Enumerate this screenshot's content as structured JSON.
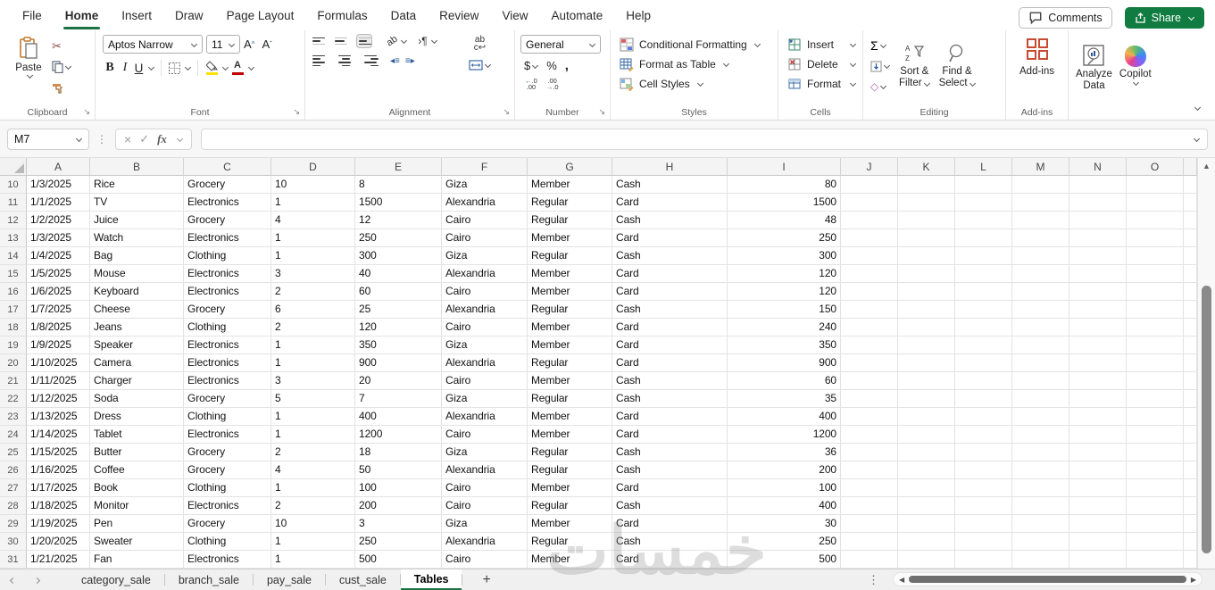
{
  "colors": {
    "excel_green": "#107C41",
    "active_tab_underline": "#1E7145",
    "fill_swatch": "#FFE100",
    "fontcolor_swatch": "#C00000"
  },
  "ribbon": {
    "tabs": [
      {
        "label": "File",
        "active": false
      },
      {
        "label": "Home",
        "active": true
      },
      {
        "label": "Insert",
        "active": false
      },
      {
        "label": "Draw",
        "active": false
      },
      {
        "label": "Page Layout",
        "active": false
      },
      {
        "label": "Formulas",
        "active": false
      },
      {
        "label": "Data",
        "active": false
      },
      {
        "label": "Review",
        "active": false
      },
      {
        "label": "View",
        "active": false
      },
      {
        "label": "Automate",
        "active": false
      },
      {
        "label": "Help",
        "active": false
      }
    ],
    "comments_label": "Comments",
    "share_label": "Share",
    "clipboard": {
      "label": "Clipboard",
      "paste": "Paste"
    },
    "font": {
      "label": "Font",
      "font_name": "Aptos Narrow",
      "font_size": "11",
      "bold": "B",
      "italic": "I",
      "underline": "U"
    },
    "alignment": {
      "label": "Alignment",
      "wrap": "ab"
    },
    "number": {
      "label": "Number",
      "format": "General",
      "currency": "$",
      "percent": "%",
      "comma": ","
    },
    "styles": {
      "label": "Styles",
      "items": [
        "Conditional Formatting",
        "Format as Table",
        "Cell Styles"
      ]
    },
    "cells": {
      "label": "Cells",
      "items": [
        "Insert",
        "Delete",
        "Format"
      ]
    },
    "editing": {
      "label": "Editing",
      "autosum": "Σ",
      "sort_filter_1": "Sort &",
      "sort_filter_2": "Filter",
      "find_select_1": "Find &",
      "find_select_2": "Select"
    },
    "addins": {
      "label": "Add-ins",
      "button": "Add-ins"
    },
    "misc": {
      "analyze_1": "Analyze",
      "analyze_2": "Data",
      "copilot": "Copilot"
    }
  },
  "formula_bar": {
    "name_box": "M7",
    "fx": "fx",
    "value": ""
  },
  "grid": {
    "columns": [
      "A",
      "B",
      "C",
      "D",
      "E",
      "F",
      "G",
      "H",
      "I",
      "J",
      "K",
      "L",
      "M",
      "N",
      "O"
    ],
    "rows": [
      {
        "n": "10",
        "cells": [
          "1/3/2025",
          "Rice",
          "Grocery",
          "10",
          "8",
          "Giza",
          "Member",
          "Cash",
          "80"
        ]
      },
      {
        "n": "11",
        "cells": [
          "1/1/2025",
          "TV",
          "Electronics",
          "1",
          "1500",
          "Alexandria",
          "Regular",
          "Card",
          "1500"
        ]
      },
      {
        "n": "12",
        "cells": [
          "1/2/2025",
          "Juice",
          "Grocery",
          "4",
          "12",
          "Cairo",
          "Regular",
          "Cash",
          "48"
        ]
      },
      {
        "n": "13",
        "cells": [
          "1/3/2025",
          "Watch",
          "Electronics",
          "1",
          "250",
          "Cairo",
          "Member",
          "Card",
          "250"
        ]
      },
      {
        "n": "14",
        "cells": [
          "1/4/2025",
          "Bag",
          "Clothing",
          "1",
          "300",
          "Giza",
          "Regular",
          "Cash",
          "300"
        ]
      },
      {
        "n": "15",
        "cells": [
          "1/5/2025",
          "Mouse",
          "Electronics",
          "3",
          "40",
          "Alexandria",
          "Member",
          "Card",
          "120"
        ]
      },
      {
        "n": "16",
        "cells": [
          "1/6/2025",
          "Keyboard",
          "Electronics",
          "2",
          "60",
          "Cairo",
          "Member",
          "Card",
          "120"
        ]
      },
      {
        "n": "17",
        "cells": [
          "1/7/2025",
          "Cheese",
          "Grocery",
          "6",
          "25",
          "Alexandria",
          "Regular",
          "Cash",
          "150"
        ]
      },
      {
        "n": "18",
        "cells": [
          "1/8/2025",
          "Jeans",
          "Clothing",
          "2",
          "120",
          "Cairo",
          "Member",
          "Card",
          "240"
        ]
      },
      {
        "n": "19",
        "cells": [
          "1/9/2025",
          "Speaker",
          "Electronics",
          "1",
          "350",
          "Giza",
          "Member",
          "Card",
          "350"
        ]
      },
      {
        "n": "20",
        "cells": [
          "1/10/2025",
          "Camera",
          "Electronics",
          "1",
          "900",
          "Alexandria",
          "Regular",
          "Card",
          "900"
        ]
      },
      {
        "n": "21",
        "cells": [
          "1/11/2025",
          "Charger",
          "Electronics",
          "3",
          "20",
          "Cairo",
          "Member",
          "Cash",
          "60"
        ]
      },
      {
        "n": "22",
        "cells": [
          "1/12/2025",
          "Soda",
          "Grocery",
          "5",
          "7",
          "Giza",
          "Regular",
          "Cash",
          "35"
        ]
      },
      {
        "n": "23",
        "cells": [
          "1/13/2025",
          "Dress",
          "Clothing",
          "1",
          "400",
          "Alexandria",
          "Member",
          "Card",
          "400"
        ]
      },
      {
        "n": "24",
        "cells": [
          "1/14/2025",
          "Tablet",
          "Electronics",
          "1",
          "1200",
          "Cairo",
          "Member",
          "Card",
          "1200"
        ]
      },
      {
        "n": "25",
        "cells": [
          "1/15/2025",
          "Butter",
          "Grocery",
          "2",
          "18",
          "Giza",
          "Regular",
          "Cash",
          "36"
        ]
      },
      {
        "n": "26",
        "cells": [
          "1/16/2025",
          "Coffee",
          "Grocery",
          "4",
          "50",
          "Alexandria",
          "Regular",
          "Cash",
          "200"
        ]
      },
      {
        "n": "27",
        "cells": [
          "1/17/2025",
          "Book",
          "Clothing",
          "1",
          "100",
          "Cairo",
          "Member",
          "Card",
          "100"
        ]
      },
      {
        "n": "28",
        "cells": [
          "1/18/2025",
          "Monitor",
          "Electronics",
          "2",
          "200",
          "Cairo",
          "Regular",
          "Cash",
          "400"
        ]
      },
      {
        "n": "29",
        "cells": [
          "1/19/2025",
          "Pen",
          "Grocery",
          "10",
          "3",
          "Giza",
          "Member",
          "Card",
          "30"
        ]
      },
      {
        "n": "30",
        "cells": [
          "1/20/2025",
          "Sweater",
          "Clothing",
          "1",
          "250",
          "Alexandria",
          "Regular",
          "Cash",
          "250"
        ]
      },
      {
        "n": "31",
        "cells": [
          "1/21/2025",
          "Fan",
          "Electronics",
          "1",
          "500",
          "Cairo",
          "Member",
          "Card",
          "500"
        ]
      }
    ]
  },
  "sheet_bar": {
    "tabs": [
      {
        "label": "category_sale",
        "active": false
      },
      {
        "label": "branch_sale",
        "active": false
      },
      {
        "label": "pay_sale",
        "active": false
      },
      {
        "label": "cust_sale",
        "active": false
      },
      {
        "label": "Tables",
        "active": true
      }
    ],
    "add_label": "+"
  },
  "watermark": "خمسات"
}
